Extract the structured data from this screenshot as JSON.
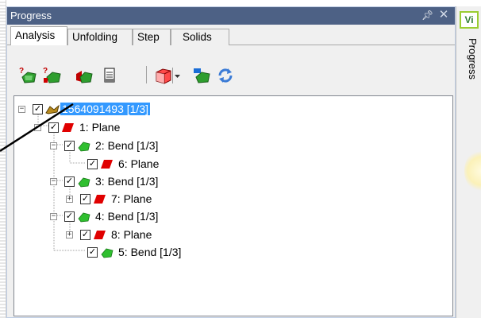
{
  "panel": {
    "title": "Progress"
  },
  "tabs": [
    {
      "label": "Analysis",
      "active": true
    },
    {
      "label": "Unfolding",
      "active": false
    },
    {
      "label": "Step",
      "active": false
    },
    {
      "label": "Solids",
      "active": false
    }
  ],
  "toolbar": {
    "icons": [
      "analyze-icon",
      "analyze-marked-icon",
      "unfold-icon",
      "document-icon",
      "solid-cube-icon",
      "dropdown-arrow-icon",
      "model-icon",
      "refresh-icon"
    ]
  },
  "tree": {
    "root": {
      "label": "1564091493 [1/3]",
      "checked": true,
      "selected": true
    },
    "items": [
      {
        "label": "1: Plane",
        "type": "plane",
        "checked": true
      },
      {
        "label": "2: Bend [1/3]",
        "type": "bend",
        "checked": true
      },
      {
        "label": "6: Plane",
        "type": "plane",
        "checked": true
      },
      {
        "label": "3: Bend [1/3]",
        "type": "bend",
        "checked": true
      },
      {
        "label": "7: Plane",
        "type": "plane",
        "checked": true
      },
      {
        "label": "4: Bend [1/3]",
        "type": "bend",
        "checked": true
      },
      {
        "label": "8: Plane",
        "type": "plane",
        "checked": true
      },
      {
        "label": "5: Bend [1/3]",
        "type": "bend",
        "checked": true
      }
    ]
  },
  "right_pane": {
    "badge": "Vi",
    "label": "Progress"
  },
  "colors": {
    "titlebar": "#4d6185",
    "selection": "#3399ff",
    "plane": "#e00000",
    "bend": "#2fbf2f",
    "badge_border": "#9acd32"
  }
}
